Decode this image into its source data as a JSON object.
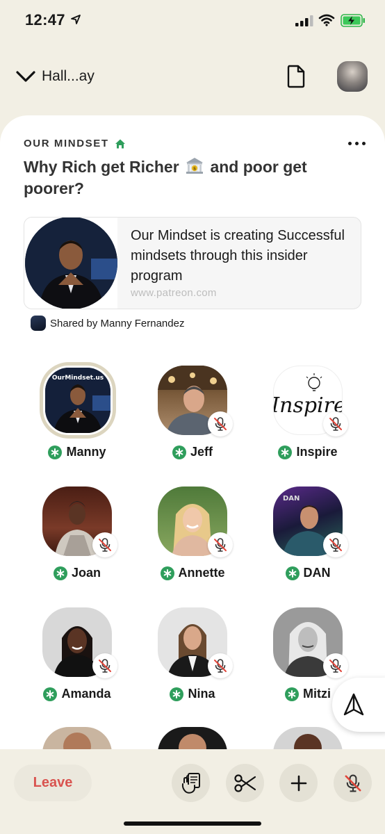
{
  "status_bar": {
    "time": "12:47"
  },
  "nav": {
    "back_label": "Hall...ay"
  },
  "room": {
    "club_name": "OUR MINDSET",
    "title_part1": "Why Rich get Richer",
    "title_part2": "and poor get poorer?"
  },
  "link_card": {
    "text": "Our Mindset is creating Successful mindsets through this insider program",
    "url": "www.patreon.com"
  },
  "shared_by": "Shared by Manny Fernandez",
  "speakers": [
    {
      "name": "Manny",
      "moderator": true,
      "muted": false,
      "speaking": true,
      "logo_text": "OurMindset.us"
    },
    {
      "name": "Jeff",
      "moderator": true,
      "muted": true
    },
    {
      "name": "Inspire",
      "moderator": true,
      "muted": true,
      "logo_text": "Inspire"
    },
    {
      "name": "Joan",
      "moderator": true,
      "muted": true
    },
    {
      "name": "Annette",
      "moderator": true,
      "muted": true
    },
    {
      "name": "DAN",
      "moderator": true,
      "muted": true,
      "avatar_text": "DAN"
    },
    {
      "name": "Amanda",
      "moderator": true,
      "muted": true
    },
    {
      "name": "Nina",
      "moderator": true,
      "muted": true
    },
    {
      "name": "Mitzi",
      "moderator": true,
      "muted": true
    }
  ],
  "bottom_bar": {
    "leave_label": "Leave"
  },
  "colors": {
    "accent_green": "#2f9e5c",
    "leave_red": "#d9534f",
    "background": "#f2efe4"
  }
}
